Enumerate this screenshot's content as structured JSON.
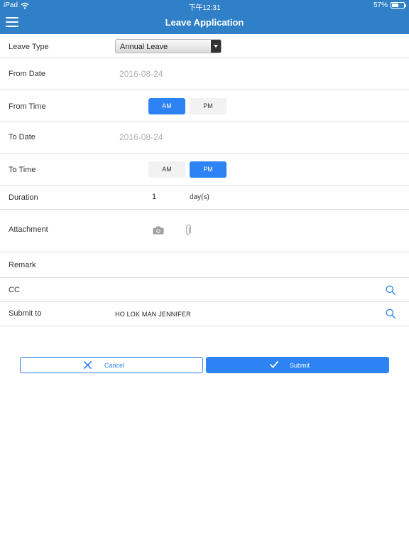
{
  "status_bar": {
    "device": "iPad",
    "time": "下午12:31",
    "battery_text": "57%",
    "battery_level": 0.57
  },
  "header": {
    "title": "Leave Application",
    "menu_icon": "hamburger-menu-icon"
  },
  "form": {
    "leave_type": {
      "label": "Leave Type",
      "value": "Annual Leave"
    },
    "from_date": {
      "label": "From Date",
      "value": "2016-08-24"
    },
    "from_time": {
      "label": "From Time",
      "options": [
        "AM",
        "PM"
      ],
      "selected": "AM"
    },
    "to_date": {
      "label": "To Date",
      "value": "2016-08-24"
    },
    "to_time": {
      "label": "To Time",
      "options": [
        "AM",
        "PM"
      ],
      "selected": "PM"
    },
    "duration": {
      "label": "Duration",
      "value": "1",
      "unit": "day(s)"
    },
    "attachment": {
      "label": "Attachment",
      "icons": [
        "camera-icon",
        "paperclip-icon"
      ]
    },
    "remark": {
      "label": "Remark"
    },
    "cc": {
      "label": "CC",
      "icon": "search-icon"
    },
    "submit_to": {
      "label": "Submit to",
      "value": "HO LOK MAN JENNIFER",
      "icon": "search-icon"
    }
  },
  "actions": {
    "cancel_label": "Cancel",
    "submit_label": "Submit"
  },
  "colors": {
    "header": "#2f80c6",
    "accent": "#2d83f3",
    "placeholder": "#b0b0b0",
    "segment_off": "#f2f2f2"
  }
}
